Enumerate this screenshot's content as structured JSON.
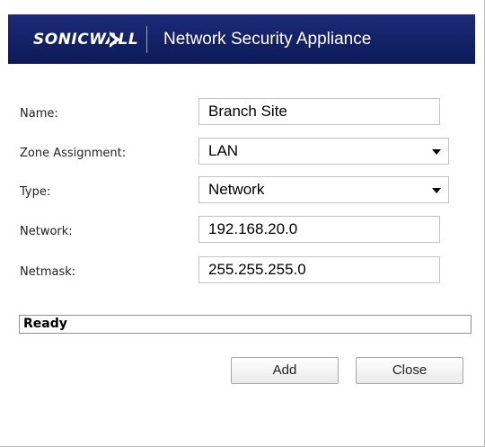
{
  "header": {
    "logo_text": "SONICWALL",
    "title": "Network Security Appliance",
    "background_color": "#0f1e5f"
  },
  "form": {
    "name_label": "Name:",
    "name_value": "Branch Site",
    "zone_label": "Zone Assignment:",
    "zone_value": "LAN",
    "type_label": "Type:",
    "type_value": "Network",
    "network_label": "Network:",
    "network_value": "192.168.20.0",
    "netmask_label": "Netmask:",
    "netmask_value": "255.255.255.0"
  },
  "status": {
    "text": "Ready"
  },
  "buttons": {
    "add_label": "Add",
    "close_label": "Close"
  }
}
